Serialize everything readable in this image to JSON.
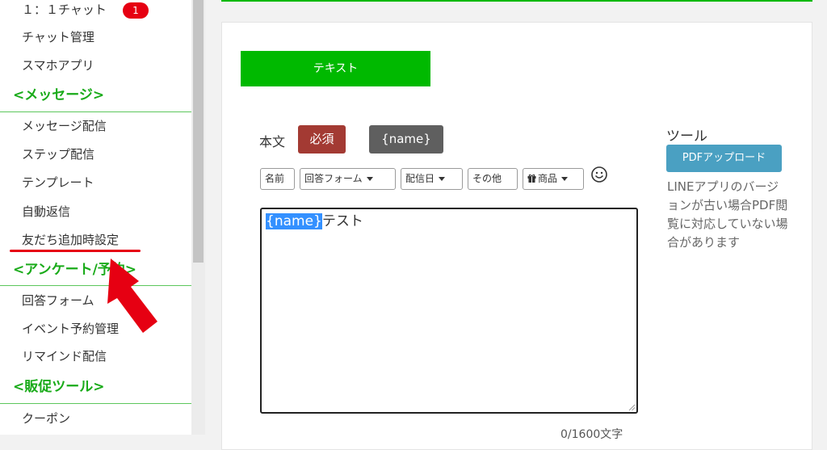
{
  "sidebar": {
    "chat": {
      "label": "１：１チャット",
      "badge": "1"
    },
    "chat_manage": "チャット管理",
    "smartphone_app": "スマホアプリ",
    "message_heading": "<メッセージ>",
    "message_items": [
      "メッセージ配信",
      "ステップ配信",
      "テンプレート",
      "自動返信",
      "友だち追加時設定"
    ],
    "survey_heading": "<アンケート/予約>",
    "survey_items": [
      "回答フォーム",
      "イベント予約管理",
      "リマインド配信"
    ],
    "promo_heading": "<販促ツール>",
    "promo_items": [
      "クーポン"
    ]
  },
  "editor": {
    "tab_label": "テキスト",
    "body_label": "本文",
    "required_label": "必須",
    "name_tag_label": "{name}",
    "toolbar": {
      "name": "名前",
      "answer_form": "回答フォーム",
      "delivery_date": "配信日",
      "other": "その他",
      "product": "商品"
    },
    "textarea": {
      "highlight": "{name}",
      "text": "テスト"
    },
    "char_counter": "0/1600文字"
  },
  "tools": {
    "heading": "ツール",
    "pdf_upload": "PDFアップロード",
    "note": "LINEアプリのバージョンが古い場合PDF閲覧に対応していない場合があります"
  },
  "colors": {
    "accent_green": "#00b900",
    "heading_green": "#1aab1a",
    "required_red": "#a33a33",
    "name_gray": "#5f5f5f",
    "pdf_blue": "#4aa0c2",
    "annotation_red": "#e60012"
  },
  "icons": [
    "gift-icon",
    "caret-down-icon",
    "smile-icon",
    "arrow-annotation-icon"
  ]
}
